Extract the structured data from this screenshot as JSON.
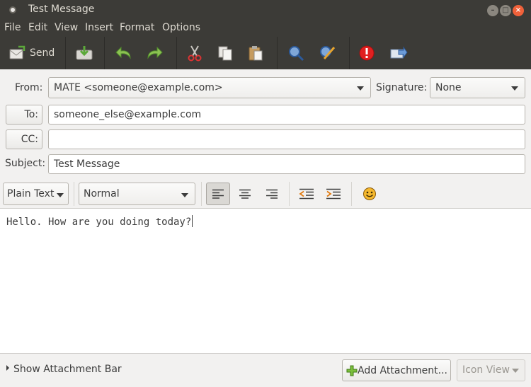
{
  "window": {
    "title": "Test Message"
  },
  "menu": [
    "File",
    "Edit",
    "View",
    "Insert",
    "Format",
    "Options"
  ],
  "toolbar": {
    "send_label": "Send"
  },
  "header": {
    "from_label": "From:",
    "from_value": "MATE <someone@example.com>",
    "signature_label": "Signature:",
    "signature_value": "None",
    "to_button": "To:",
    "to_value": "someone_else@example.com",
    "cc_button": "CC:",
    "cc_value": "",
    "subject_label": "Subject:",
    "subject_value": "Test Message"
  },
  "format": {
    "mode": "Plain Text",
    "paragraph_style": "Normal"
  },
  "editor": {
    "body": "Hello. How are you doing today?"
  },
  "attachments": {
    "toggle_label": "Show Attachment Bar",
    "add_label": "Add Attachment...",
    "view_value": "Icon View"
  },
  "colors": {
    "titlebar": "#3c3b37",
    "close_button": "#f0613a",
    "window_bg": "#f2f1f0"
  }
}
